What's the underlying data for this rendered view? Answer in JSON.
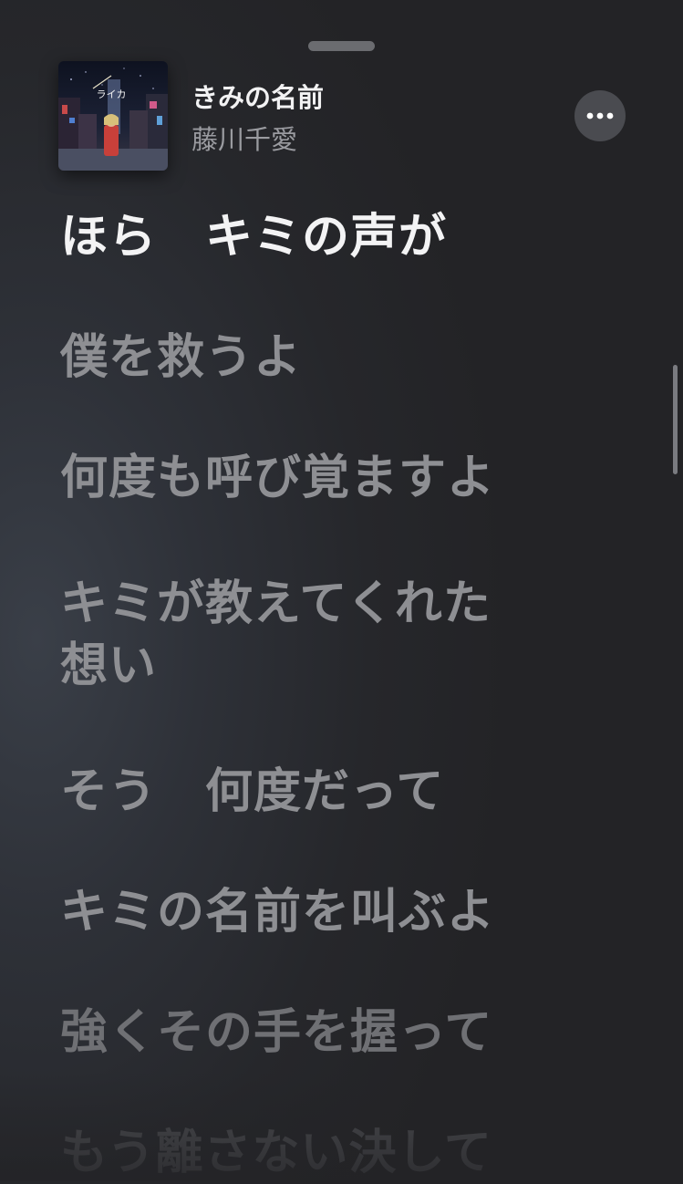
{
  "now_playing": {
    "title": "きみの名前",
    "artist": "藤川千愛",
    "artwork_icon": "album-artwork",
    "artwork_text": "ライカ",
    "more_icon": "ellipsis-icon"
  },
  "lyrics": [
    {
      "text": "ほら　キミの声が",
      "state": "active"
    },
    {
      "text": "僕を救うよ",
      "state": "upcoming"
    },
    {
      "text": "何度も呼び覚ますよ",
      "state": "upcoming"
    },
    {
      "text": "キミが教えてくれた\n想い",
      "state": "upcoming"
    },
    {
      "text": "そう　何度だって",
      "state": "upcoming"
    },
    {
      "text": "キミの名前を叫ぶよ",
      "state": "upcoming"
    },
    {
      "text": "強くその手を握って",
      "state": "upcoming"
    },
    {
      "text": "もう離さない決して",
      "state": "upcoming"
    }
  ],
  "colors": {
    "active_lyric": "#f3f3f4",
    "inactive_lyric": "#8e8f93",
    "background": "#26272b"
  }
}
